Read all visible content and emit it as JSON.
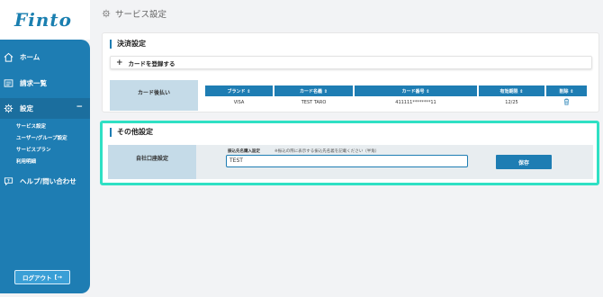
{
  "app": {
    "logo": "Finto"
  },
  "sidebar": {
    "home": "ホーム",
    "billing": "請求一覧",
    "settings": "設定",
    "sub_items": [
      "サービス設定",
      "ユーザー/グループ設定",
      "サービスプラン",
      "利用明細"
    ],
    "help": "ヘルプ/問い合わせ",
    "logout": "ログアウト"
  },
  "header": {
    "title": "サービス設定"
  },
  "payment": {
    "title": "決済設定",
    "add_card": "カードを登録する",
    "row_label": "カード後払い",
    "columns": [
      "ブランド ⇕",
      "カード名義 ⇕",
      "カード番号 ⇕",
      "有効期限 ⇕",
      "削除 ⇕"
    ],
    "rows": [
      {
        "brand": "VISA",
        "holder": "TEST TARO",
        "number": "411111********11",
        "expiry": "12/25"
      }
    ]
  },
  "other": {
    "title": "その他設定",
    "row_label": "自社口座設定",
    "field_label": "振込先名購入設定",
    "field_note": "※振込の際に表示する振込先名義を記載ください（半角）",
    "field_value": "TEST",
    "save": "保存"
  }
}
